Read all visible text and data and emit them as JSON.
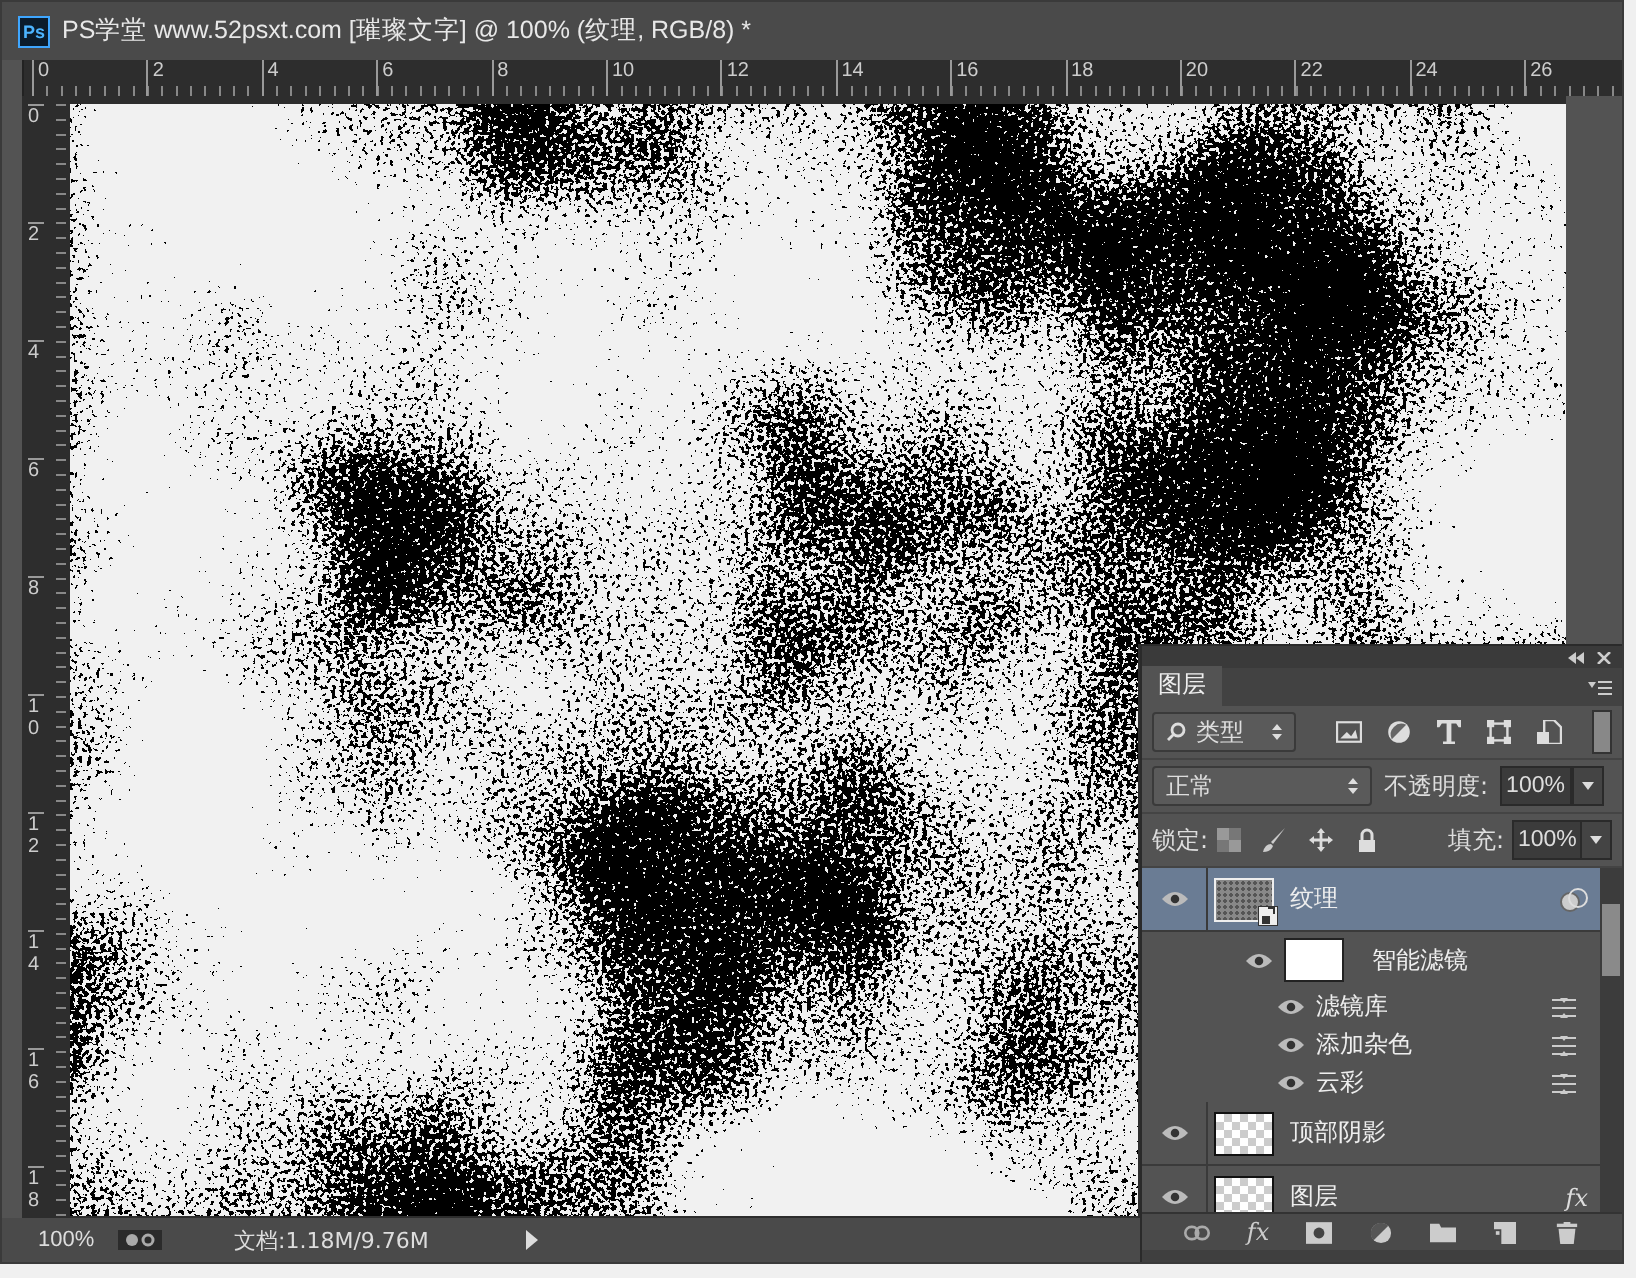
{
  "window": {
    "app_icon": "Ps",
    "title": "PS学堂 www.52psxt.com [璀璨文字] @ 100% (纹理, RGB/8) *"
  },
  "rulers": {
    "horizontal": [
      "0",
      "2",
      "4",
      "6",
      "8",
      "10",
      "12",
      "14",
      "16",
      "18",
      "20",
      "22",
      "24",
      "26"
    ],
    "vertical": [
      "0",
      "2",
      "4",
      "6",
      "8",
      "10",
      "12",
      "14",
      "16",
      "18"
    ]
  },
  "status_bar": {
    "zoom": "100%",
    "document": "文档:1.18M/9.76M"
  },
  "layers_panel": {
    "tab": "图层",
    "filter": "类型",
    "blend_mode": "正常",
    "opacity_label": "不透明度:",
    "opacity": "100%",
    "lock_label": "锁定:",
    "fill_label": "填充:",
    "fill": "100%",
    "layers": [
      {
        "name": "纹理",
        "kind": "smart",
        "visible": true,
        "selected": true,
        "children": [
          {
            "name": "智能滤镜",
            "kind": "smart-filters",
            "visible": true,
            "children": [
              {
                "name": "滤镜库",
                "kind": "filter",
                "visible": true
              },
              {
                "name": "添加杂色",
                "kind": "filter",
                "visible": true
              },
              {
                "name": "云彩",
                "kind": "filter",
                "visible": true
              }
            ]
          }
        ]
      },
      {
        "name": "顶部阴影",
        "kind": "pixel",
        "visible": true,
        "selected": false
      },
      {
        "name": "图层",
        "kind": "pixel",
        "visible": true,
        "selected": false,
        "effects": "fx"
      }
    ],
    "fx_button": "fx"
  }
}
